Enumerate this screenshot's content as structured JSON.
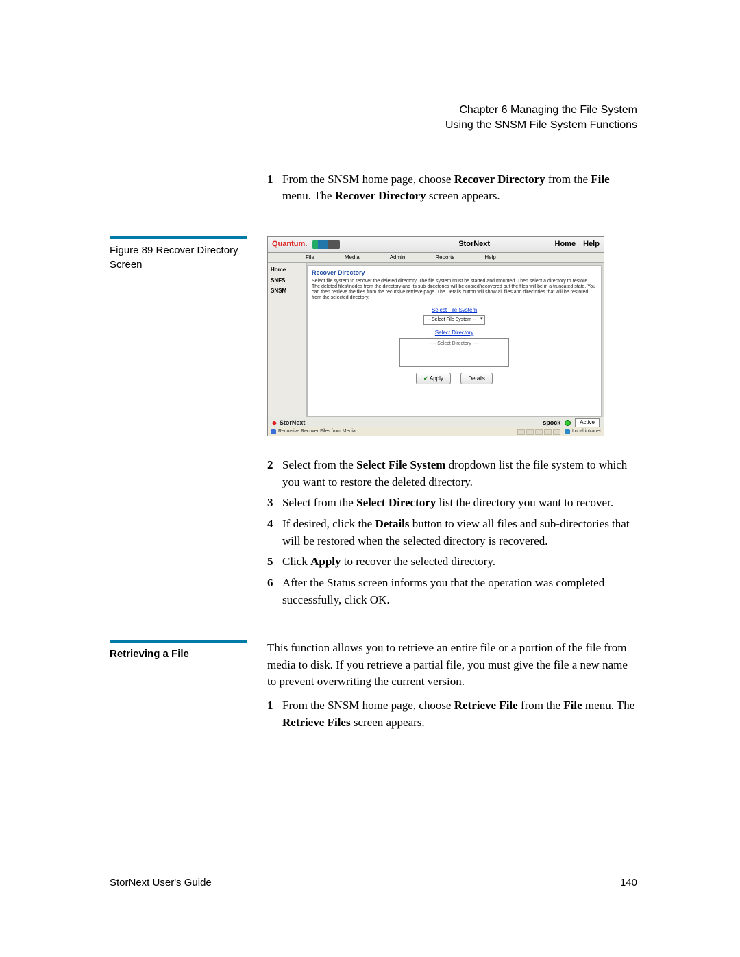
{
  "header": {
    "chapter": "Chapter 6  Managing the File System",
    "section": "Using the SNSM File System Functions"
  },
  "step1": {
    "num": "1",
    "prefix": "From the SNSM home page, choose ",
    "b1": "Recover Directory",
    "mid1": " from the ",
    "b2": "File",
    "mid2": " menu. The ",
    "b3": "Recover Directory",
    "suffix": " screen appears."
  },
  "figure_caption": "Figure 89  Recover Directory Screen",
  "shot": {
    "brand": "Quantum",
    "product": "StorNext",
    "toplinks": {
      "home": "Home",
      "help": "Help"
    },
    "menus": {
      "file": "File",
      "media": "Media",
      "admin": "Admin",
      "reports": "Reports",
      "help": "Help"
    },
    "side": {
      "home": "Home",
      "snfs": "SNFS",
      "snsm": "SNSM"
    },
    "panel_title": "Recover Directory",
    "panel_desc": "Select file system to recover the deleted directory. The file system must be started and mounted. Then select a directory to restore. The deleted files/inodes from the directory and its sub-directories will be copied/recovered but the files will be in a truncated state. You can then retrieve the files from the recursive retrieve page. The Details button will show all files and directories that will be restored from the selected directory.",
    "select_fs_label": "Select File System",
    "select_fs_value": "-- Select File System --",
    "select_dir_label": "Select Directory",
    "select_dir_value": "---- Select Directory ----",
    "apply_btn": "Apply",
    "details_btn": "Details",
    "footer_host": "spock",
    "footer_state": "Active",
    "status_left": "Recursive Recover Files from Media",
    "status_right": "Local intranet"
  },
  "step2": {
    "num": "2",
    "p1": "Select from the ",
    "b1": "Select File System",
    "p2": " dropdown list the file system to which you want to restore the deleted directory."
  },
  "step3": {
    "num": "3",
    "p1": "Select from the ",
    "b1": "Select Directory",
    "p2": " list the directory you want to recover."
  },
  "step4": {
    "num": "4",
    "p1": "If desired, click the ",
    "b1": "Details",
    "p2": " button to view all files and sub-directories that will be restored when the selected directory is recovered."
  },
  "step5": {
    "num": "5",
    "p1": "Click ",
    "b1": "Apply",
    "p2": " to recover the selected directory."
  },
  "step6": {
    "num": "6",
    "p1": "After the Status screen informs you that the operation was completed successfully, click OK."
  },
  "retrieve_heading": "Retrieving a File",
  "retrieve_intro": "This function allows you to retrieve an entire file or a portion of the file from media to disk. If you retrieve a partial file, you must give the file a new name to prevent overwriting the current version.",
  "retrieve_step1": {
    "num": "1",
    "p1": "From the SNSM home page, choose ",
    "b1": "Retrieve File",
    "p2": " from the ",
    "b2": "File",
    "p3": " menu. The ",
    "b3": "Retrieve Files",
    "p4": " screen appears."
  },
  "footer": {
    "guide": "StorNext User's Guide",
    "page": "140"
  }
}
